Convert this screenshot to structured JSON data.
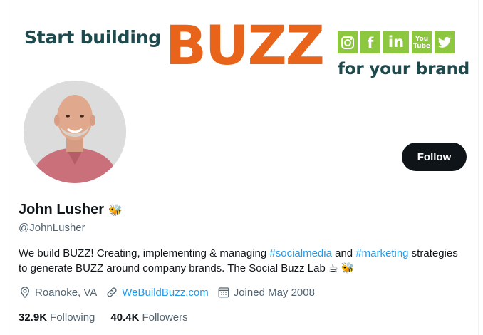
{
  "banner": {
    "start_text": "Start building",
    "buzz_text": "BUZZ",
    "tagline": "for your brand",
    "social_icons": [
      {
        "icon": "instagram-icon",
        "glyph": "◎"
      },
      {
        "icon": "facebook-icon",
        "glyph": "f"
      },
      {
        "icon": "linkedin-icon",
        "glyph": "in"
      },
      {
        "icon": "youtube-icon",
        "glyph_top": "You",
        "glyph_bottom": "Tube"
      },
      {
        "icon": "twitter-icon",
        "glyph": "🐦"
      }
    ],
    "colors": {
      "green": "#8dc63f",
      "orange": "#e8641b",
      "teal": "#1f4a4d"
    }
  },
  "profile": {
    "display_name": "John Lusher",
    "name_emoji": "🐝",
    "handle": "@JohnLusher",
    "follow_label": "Follow"
  },
  "bio": {
    "part1": "We build BUZZ! Creating, implementing & managing ",
    "tag1": "#socialmedia",
    "part2": " and ",
    "tag2": "#marketing",
    "part3": " strategies to generate BUZZ around company brands.          The Social Buzz Lab ☕ 🐝"
  },
  "meta": {
    "location": "Roanoke, VA",
    "website": "WeBuildBuzz.com",
    "joined": "Joined May 2008"
  },
  "stats": {
    "following_count": "32.9K",
    "following_label": "Following",
    "followers_count": "40.4K",
    "followers_label": "Followers"
  },
  "colors": {
    "accent": "#1d9bf0",
    "text": "#0f1419",
    "secondary": "#536471"
  }
}
